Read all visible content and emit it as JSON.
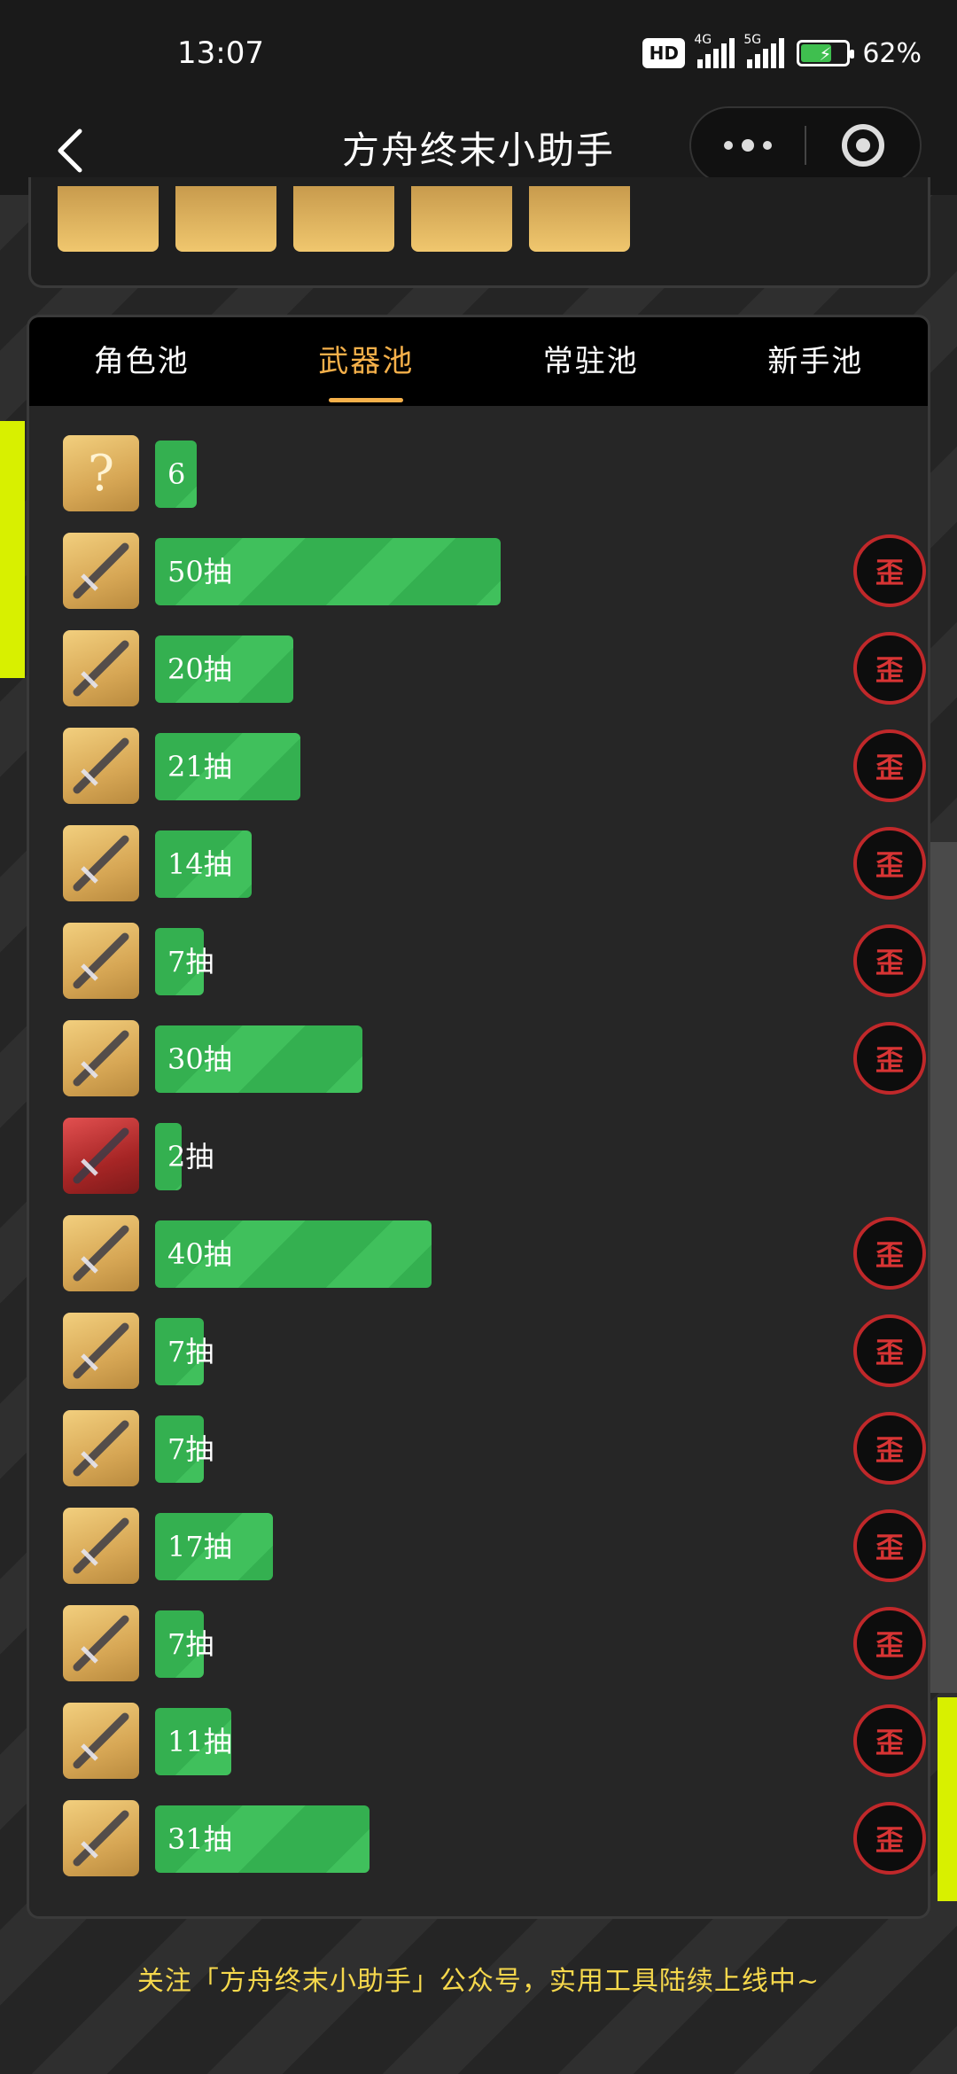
{
  "status_bar": {
    "time": "13:07",
    "hd_label": "HD",
    "net1": "4G",
    "net2": "5G",
    "battery_pct": "62%"
  },
  "header": {
    "title": "方舟终末小助手"
  },
  "tabs": [
    {
      "label": "角色池",
      "active": false
    },
    {
      "label": "武器池",
      "active": true
    },
    {
      "label": "常驻池",
      "active": false
    },
    {
      "label": "新手池",
      "active": false
    }
  ],
  "colors": {
    "accent": "#f5b04a",
    "bar": "#34b050",
    "wai": "#c0282a",
    "footer": "#f6d84c"
  },
  "wai_label": "歪",
  "pulls": [
    {
      "icon": "unknown-icon",
      "label": "6",
      "value": 6,
      "wai": false
    },
    {
      "icon": "gold-rifle-icon",
      "label": "50抽",
      "value": 50,
      "wai": true
    },
    {
      "icon": "silver-armor-icon",
      "label": "20抽",
      "value": 20,
      "wai": true
    },
    {
      "icon": "gold-rifle-icon",
      "label": "21抽",
      "value": 21,
      "wai": true
    },
    {
      "icon": "blue-blade-icon",
      "label": "14抽",
      "value": 14,
      "wai": true
    },
    {
      "icon": "silver-sword-icon",
      "label": "7抽",
      "value": 7,
      "wai": true
    },
    {
      "icon": "silver-sword-icon",
      "label": "30抽",
      "value": 30,
      "wai": true
    },
    {
      "icon": "red-blade-icon",
      "label": "2抽",
      "value": 2,
      "wai": false
    },
    {
      "icon": "blue-blade-icon",
      "label": "40抽",
      "value": 40,
      "wai": true
    },
    {
      "icon": "silver-claw-icon",
      "label": "7抽",
      "value": 7,
      "wai": true
    },
    {
      "icon": "silver-armor-icon",
      "label": "7抽",
      "value": 7,
      "wai": true
    },
    {
      "icon": "crimson-greatsword-icon",
      "label": "17抽",
      "value": 17,
      "wai": true
    },
    {
      "icon": "crimson-greatsword-icon",
      "label": "7抽",
      "value": 7,
      "wai": true
    },
    {
      "icon": "silver-armor-icon",
      "label": "11抽",
      "value": 11,
      "wai": true
    },
    {
      "icon": "crimson-greatsword-icon",
      "label": "31抽",
      "value": 31,
      "wai": true
    }
  ],
  "footer_note": "关注「方舟终末小助手」公众号，实用工具陆续上线中~"
}
